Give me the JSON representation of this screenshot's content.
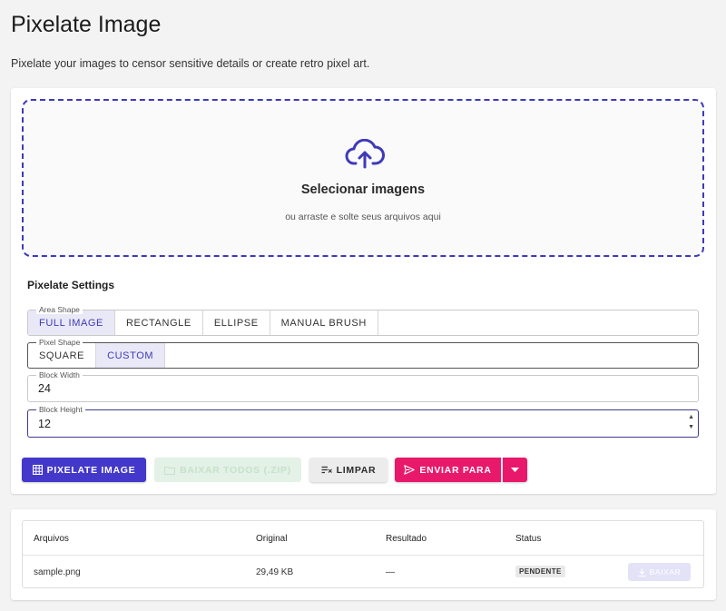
{
  "header": {
    "title": "Pixelate Image",
    "subtitle": "Pixelate your images to censor sensitive details or create retro pixel art."
  },
  "dropzone": {
    "icon": "cloud-upload-icon",
    "title": "Selecionar imagens",
    "subtitle": "ou arraste e solte seus arquivos aqui",
    "accent_color": "#3f3ab8"
  },
  "settings": {
    "title": "Pixelate Settings",
    "area_shape": {
      "label": "Area Shape",
      "options": [
        "FULL IMAGE",
        "RECTANGLE",
        "ELLIPSE",
        "MANUAL BRUSH"
      ],
      "selected": "FULL IMAGE"
    },
    "pixel_shape": {
      "label": "Pixel Shape",
      "options": [
        "SQUARE",
        "CUSTOM"
      ],
      "selected": "CUSTOM"
    },
    "block_width": {
      "label": "Block Width",
      "value": "24"
    },
    "block_height": {
      "label": "Block Height",
      "value": "12"
    }
  },
  "actions": {
    "pixelate_label": "PIXELATE IMAGE",
    "zip_label": "BAIXAR TODOS (.ZIP)",
    "clear_label": "LIMPAR",
    "send_label": "ENVIAR PARA",
    "pixelate_color": "#4338ca",
    "send_color": "#e8196b"
  },
  "files": {
    "headers": [
      "Arquivos",
      "Original",
      "Resultado",
      "Status"
    ],
    "rows": [
      {
        "name": "sample.png",
        "original": "29,49 KB",
        "result": "—",
        "status": "PENDENTE",
        "download_label": "BAIXAR"
      }
    ]
  }
}
